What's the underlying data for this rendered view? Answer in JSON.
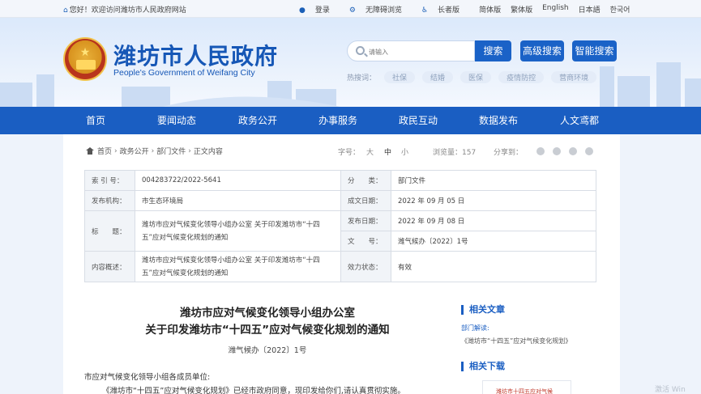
{
  "topbar": {
    "welcome": "您好！欢迎访问潍坊市人民政府网站",
    "login": "登录",
    "accessible": "无障碍浏览",
    "elder": "长者版",
    "simplified": "简体版",
    "traditional": "繁体版",
    "english": "English",
    "japanese": "日本語",
    "korean": "한국어"
  },
  "header": {
    "title": "潍坊市人民政府",
    "subtitle": "People's Government of Weifang City",
    "search_placeholder": "请输入",
    "search_button": "搜索",
    "advanced_button": "高级搜索",
    "smart_button": "智能搜索",
    "hotwords_label": "热搜词：",
    "hotwords": [
      "社保",
      "结婚",
      "医保",
      "疫情防控",
      "营商环境"
    ]
  },
  "nav": [
    "首页",
    "要闻动态",
    "政务公开",
    "办事服务",
    "政民互动",
    "数据发布",
    "人文鸢都"
  ],
  "breadcrumb": [
    "首页",
    "政务公开",
    "部门文件",
    "正文内容"
  ],
  "tools": {
    "font_label": "字号：",
    "font_big": "大",
    "font_mid": "中",
    "font_small": "小",
    "views": "浏览量：157",
    "share": "分享到："
  },
  "meta": {
    "index_label": "索 引 号：",
    "index_value": "004283722/2022-5641",
    "category_label": "分　　类：",
    "category_value": "部门文件",
    "issuer_label": "发布机构：",
    "issuer_value": "市生态环境局",
    "created_label": "成文日期：",
    "created_value": "2022 年 09 月 05 日",
    "title_label": "标　　题：",
    "title_value": "潍坊市应对气候变化领导小组办公室 关于印发潍坊市“十四五”应对气候变化规划的通知",
    "published_label": "发布日期：",
    "published_value": "2022 年 09 月 08 日",
    "docno_label": "文　　号：",
    "docno_value": "潍气候办〔2022〕1号",
    "summary_label": "内容概述：",
    "summary_value": "潍坊市应对气候变化领导小组办公室 关于印发潍坊市“十四五”应对气候变化规划的通知",
    "validity_label": "效力状态：",
    "validity_value": "有效"
  },
  "document": {
    "title_line1": "潍坊市应对气候变化领导小组办公室",
    "title_line2": "关于印发潍坊市“十四五”应对气候变化规划的通知",
    "number": "潍气候办〔2022〕1号",
    "para1": "市应对气候变化领导小组各成员单位:",
    "para2": "《潍坊市“十四五”应对气候变化规划》已经市政府同意，现印发给你们,请认真贯彻实施。"
  },
  "sidebar": {
    "related_header": "相关文章",
    "related_kind": "部门解读:",
    "related_text": "《潍坊市“十四五”应对气候变化规划》",
    "download_header": "相关下载",
    "download_card": "潍坊市十四五应对气候"
  },
  "watermark": "激活 Win"
}
